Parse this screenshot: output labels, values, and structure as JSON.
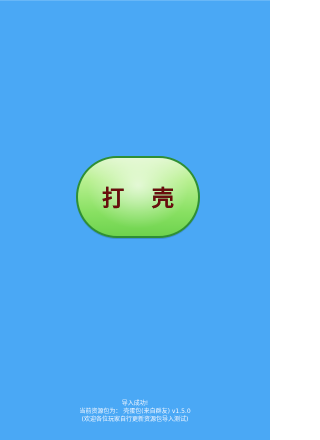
{
  "app": {
    "background_color": "#4aa8f5",
    "button": {
      "label": "打 壳",
      "fill_top": "#dff7cb",
      "fill_bottom": "#6ed34e",
      "border": "#2f8f34",
      "text_color": "#6b0c0c"
    },
    "status": {
      "line1": "导入成功!",
      "line2": "当前资源包为：  壳蛋包(来自群友) v1.5.0",
      "line3": "(欢迎各位玩家自行更新资源包导入测试)"
    }
  }
}
